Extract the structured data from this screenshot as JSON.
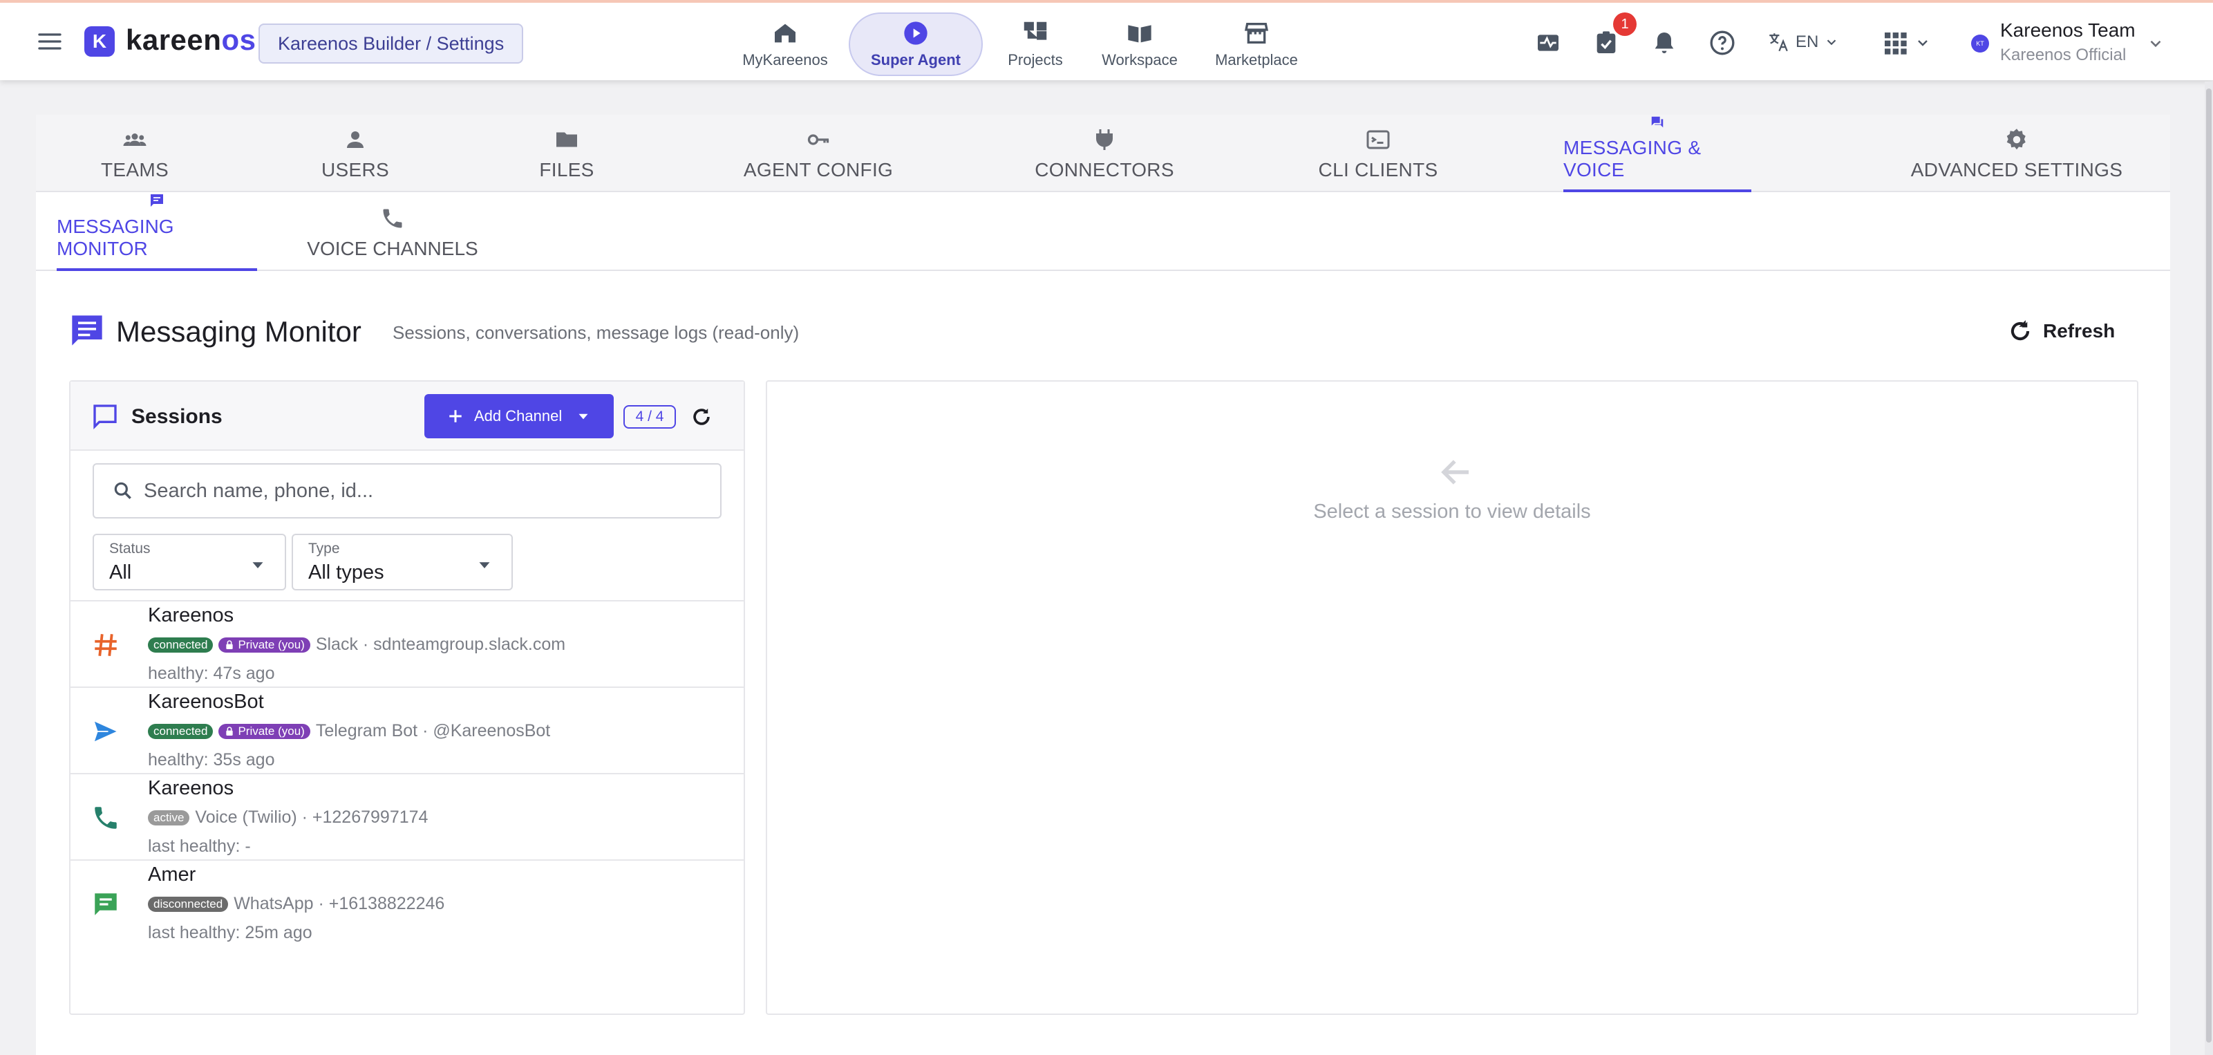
{
  "app": {
    "brand_part1": "kareen",
    "brand_part2": "os",
    "breadcrumb": "Kareenos Builder / Settings"
  },
  "nav": {
    "items": [
      {
        "label": "MyKareenos",
        "icon": "house-icon"
      },
      {
        "label": "Super Agent",
        "icon": "play-circle-icon",
        "active": true
      },
      {
        "label": "Projects",
        "icon": "hierarchy-icon"
      },
      {
        "label": "Workspace",
        "icon": "open-book-icon"
      },
      {
        "label": "Marketplace",
        "icon": "store-icon"
      }
    ]
  },
  "header": {
    "notification_count": "1",
    "language": "EN",
    "user_name": "Kareenos Team",
    "user_org": "Kareenos Official",
    "user_initials": "KT"
  },
  "tabs": [
    {
      "label": "TEAMS",
      "icon": "groups-icon"
    },
    {
      "label": "USERS",
      "icon": "person-icon"
    },
    {
      "label": "FILES",
      "icon": "folder-icon"
    },
    {
      "label": "AGENT CONFIG",
      "icon": "key-icon"
    },
    {
      "label": "CONNECTORS",
      "icon": "plug-icon"
    },
    {
      "label": "CLI CLIENTS",
      "icon": "terminal-icon"
    },
    {
      "label": "MESSAGING & VOICE",
      "icon": "chat-bubbles-icon",
      "active": true
    },
    {
      "label": "ADVANCED SETTINGS",
      "icon": "gear-icon"
    }
  ],
  "subtabs": [
    {
      "label": "MESSAGING MONITOR",
      "icon": "message-icon",
      "active": true
    },
    {
      "label": "VOICE CHANNELS",
      "icon": "phone-icon"
    }
  ],
  "page": {
    "title": "Messaging Monitor",
    "subtitle": "Sessions, conversations, message logs (read-only)",
    "refresh_label": "Refresh"
  },
  "sessions": {
    "title": "Sessions",
    "add_channel_label": "Add Channel",
    "count": "4 / 4",
    "search_placeholder": "Search name, phone, id...",
    "filters": {
      "status_label": "Status",
      "status_value": "All",
      "type_label": "Type",
      "type_value": "All types"
    },
    "rows": [
      {
        "name": "Kareenos",
        "status": "connected",
        "private": "Private (you)",
        "detail": "Slack · sdnteamgroup.slack.com",
        "health": "healthy: 47s ago",
        "icon": "hashtag-icon",
        "icon_color": "#e8632b"
      },
      {
        "name": "KareenosBot",
        "status": "connected",
        "private": "Private (you)",
        "detail": "Telegram Bot · @KareenosBot",
        "health": "healthy: 35s ago",
        "icon": "send-icon",
        "icon_color": "#2e86de"
      },
      {
        "name": "Kareenos",
        "status": "active",
        "private": "",
        "detail": "Voice (Twilio) · +12267997174",
        "health": "last healthy: -",
        "icon": "phone-icon",
        "icon_color": "#26806b"
      },
      {
        "name": "Amer",
        "status": "disconnected",
        "private": "",
        "detail": "WhatsApp · +16138822246",
        "health": "last healthy: 25m ago",
        "icon": "message-icon",
        "icon_color": "#3aa357"
      }
    ]
  },
  "details": {
    "empty_hint": "Select a session to view details"
  },
  "colors": {
    "accent": "#4f46e5",
    "badge_red": "#e53935"
  }
}
